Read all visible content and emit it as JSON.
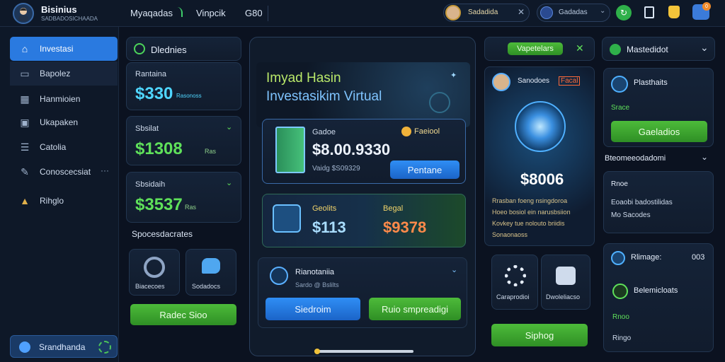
{
  "topbar": {
    "brand_title": "Bisinius",
    "brand_subtitle": "SADBADOSICHAADA",
    "nav": [
      "Myaqadas",
      "Vinpcik",
      "G80"
    ],
    "user_pill": "Sadadida",
    "search_pill": "Gadadas"
  },
  "sidebar": {
    "items": [
      {
        "label": "Investasi",
        "icon": "home-icon"
      },
      {
        "label": "Bapolez",
        "icon": "briefcase-icon"
      },
      {
        "label": "Hanmioien",
        "icon": "calendar-icon"
      },
      {
        "label": "Ukapaken",
        "icon": "card-icon"
      },
      {
        "label": "Catolia",
        "icon": "document-icon"
      },
      {
        "label": "Conoscecsiat",
        "icon": "tools-icon"
      },
      {
        "label": "Rihglo",
        "icon": "chart-icon"
      }
    ],
    "more_glyph": "···",
    "footer_label": "Srandhanda"
  },
  "left_col": {
    "header": "Dlednies",
    "card1": {
      "label": "Rantaina",
      "value": "$330",
      "unit": "Rasonoss"
    },
    "card2": {
      "label": "Sbsilat",
      "value": "$1308",
      "unit": "Ras"
    },
    "card3": {
      "label": "Sbsidaih",
      "value": "$3537",
      "unit": "Ras"
    },
    "section_title": "Spocesdacrates",
    "tile1_label": "Biacecoes",
    "tile2_label": "Sodadocs",
    "button": "Radec Sioo"
  },
  "center": {
    "title": "Imyad Hasin",
    "subtitle": "Investasikim Virtual",
    "card1": {
      "label": "Gadoe",
      "tag": "Faeiool",
      "value": "$8.00.9330",
      "sub": "Vaidg $S09329",
      "button": "Pentane"
    },
    "card2": {
      "label": "Geolits",
      "value": "$113",
      "label2": "Begal",
      "value2": "$9378"
    },
    "card3": {
      "title": "Rianotaniia",
      "sub": "Sardo @ Bslilts",
      "btn1": "Siedroim",
      "btn2": "Ruio smpreadigi"
    }
  },
  "right1": {
    "top_btn": "Vapetelars",
    "user_name": "Sanodoes",
    "user_tag": "Facal",
    "value": "$8006",
    "desc": [
      "Rrasban foeng nsingdoroa",
      "Hoeo bosiol ein narusbsiion",
      "Kovkey tue nolouto briidis",
      "Sonaonaoss"
    ],
    "tile1_label": "Caraprodioi",
    "tile2_label": "Dwoleliacso",
    "button": "Siphog"
  },
  "right2": {
    "header": "Mastedidot",
    "card1": {
      "title": "Plasthaits",
      "sub": "Srace",
      "button": "Gaeladios"
    },
    "section_title": "Bteomeeodadomi",
    "card2": {
      "line1": "Rnoe",
      "line2": "Eoaobi badostilidas",
      "line3": "Mo Sacodes"
    },
    "card3": {
      "title": "Rlimage:",
      "count": "003",
      "sub": "Belemicloats",
      "line1": "Rnoo",
      "line2": "Ringo"
    }
  },
  "colors": {
    "accent_green": "#5fe05a",
    "accent_cyan": "#4fd6ff",
    "accent_blue": "#2f8ef5",
    "bg": "#0b1220"
  }
}
